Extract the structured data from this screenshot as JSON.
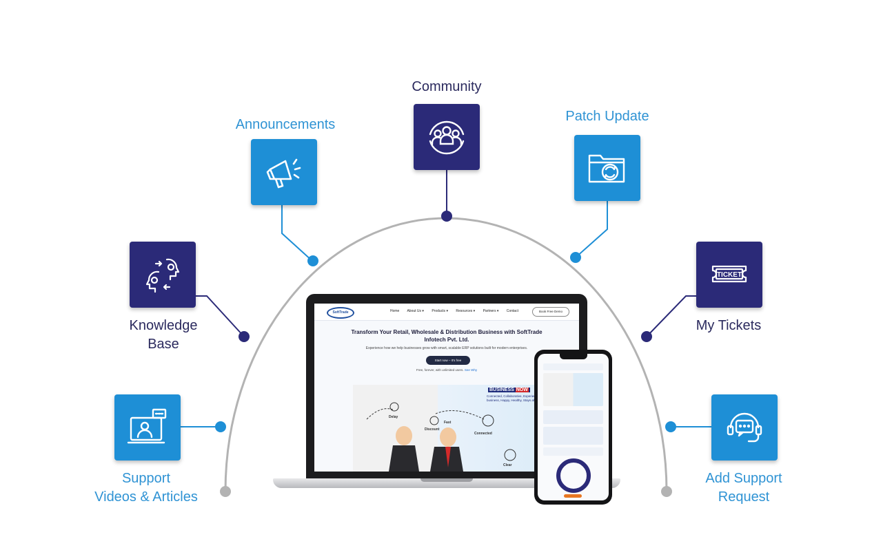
{
  "items": [
    {
      "id": "community",
      "label_lines": [
        "Community"
      ],
      "icon": "community-group-icon"
    },
    {
      "id": "announcements",
      "label_lines": [
        "Announcements"
      ],
      "icon": "megaphone-icon"
    },
    {
      "id": "patch_update",
      "label_lines": [
        "Patch Update"
      ],
      "icon": "folder-sync-icon"
    },
    {
      "id": "knowledge_base",
      "label_lines": [
        "Knowledge",
        "Base"
      ],
      "icon": "idea-heads-icon"
    },
    {
      "id": "my_tickets",
      "label_lines": [
        "My Tickets"
      ],
      "icon": "ticket-icon"
    },
    {
      "id": "support_videos",
      "label_lines": [
        "Support",
        "Videos & Articles"
      ],
      "icon": "video-call-icon"
    },
    {
      "id": "add_support",
      "label_lines": [
        "Add Support",
        "Request"
      ],
      "icon": "headset-chat-icon"
    }
  ],
  "ticket_icon_text": "TICKET",
  "colors": {
    "blue": "#1e8fd6",
    "navy": "#2b2a78",
    "label_blue": "#2f93d4",
    "label_navy": "#2b2a5e",
    "arc": "#b3b3b3"
  },
  "laptop": {
    "logo": "SoftTrade",
    "nav": [
      "Home",
      "About Us ▾",
      "Products ▾",
      "Resources ▾",
      "Partners ▾",
      "Contact"
    ],
    "demo_button": "Book Free Demo",
    "hero_title": "Transform Your Retail, Wholesale & Distribution Business with SoftTrade Infotech Pvt. Ltd.",
    "hero_sub": "Experience how we help businesses grow with smart, scalable ERP solutions built for modern enterprises.",
    "hero_button": "Start now – It's free",
    "hero_note": "Free, forever, with unlimited users.",
    "hero_note_link": "See Why",
    "banner_a": "BUSINESS",
    "banner_b": "NOW",
    "banner_sub": "Connected, Collaborative, Experiential business, Happy, Healthy, Stays ahead",
    "stage_words": [
      "Delay",
      "Discount",
      "Fast",
      "Connected",
      "Clear"
    ]
  }
}
